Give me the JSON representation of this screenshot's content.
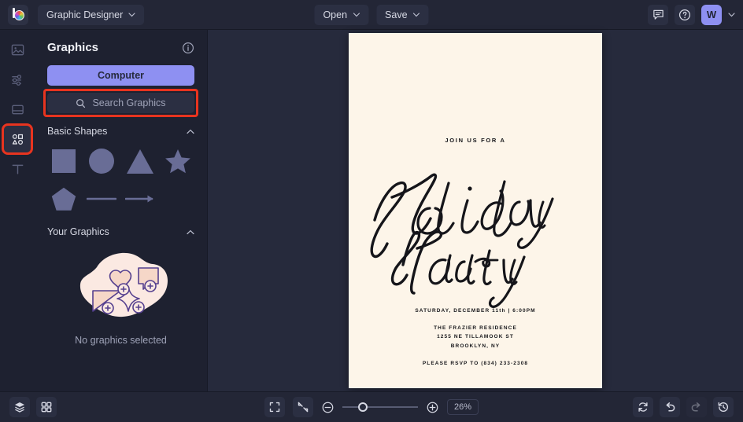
{
  "app": {
    "name": "BeFunky Graphic Designer",
    "logo_icon": "befunky-color-wheel-logo",
    "document_name": "Graphic Designer"
  },
  "topbar": {
    "open_label": "Open",
    "save_label": "Save",
    "open_icon": "chevron-down-icon",
    "save_icon": "chevron-down-icon",
    "doc_chevron_icon": "chevron-down-icon",
    "feedback_icon": "chat-bubble-icon",
    "help_icon": "help-circle-icon",
    "avatar_initial": "W",
    "avatar_chevron_icon": "chevron-down-icon"
  },
  "rail": {
    "items": [
      {
        "name": "image-tool",
        "icon": "image-icon",
        "active": false
      },
      {
        "name": "edit-tool",
        "icon": "sliders-icon",
        "active": false
      },
      {
        "name": "template-tool",
        "icon": "frame-icon",
        "active": false
      },
      {
        "name": "graphics-tool",
        "icon": "shapes-grid-icon",
        "active": true
      },
      {
        "name": "text-tool",
        "icon": "text-t-icon",
        "active": false
      }
    ]
  },
  "panel": {
    "title": "Graphics",
    "info_icon": "info-circle-icon",
    "computer_button": "Computer",
    "search_placeholder": "Search Graphics",
    "search_icon": "search-icon",
    "sections": [
      {
        "title": "Basic Shapes",
        "collapse_icon": "chevron-up-icon"
      },
      {
        "title": "Your Graphics",
        "collapse_icon": "chevron-up-icon"
      }
    ],
    "shapes": [
      {
        "name": "square-shape",
        "icon": "square-icon"
      },
      {
        "name": "circle-shape",
        "icon": "circle-icon"
      },
      {
        "name": "triangle-shape",
        "icon": "triangle-icon"
      },
      {
        "name": "star-shape",
        "icon": "star-icon"
      },
      {
        "name": "pentagon-shape",
        "icon": "pentagon-icon"
      },
      {
        "name": "line-shape",
        "icon": "line-icon"
      },
      {
        "name": "arrow-shape",
        "icon": "arrow-icon"
      }
    ],
    "empty_state": "No graphics selected",
    "empty_illustration_icon": "graphics-blob-illustration"
  },
  "canvas": {
    "eyebrow": "JOIN US FOR A",
    "headline_line1": "Holiday",
    "headline_line2": "Party",
    "date_line": "SATURDAY, DECEMBER 11th | 6:00PM",
    "venue": "THE FRAZIER RESIDENCE",
    "street": "1255 NE TILLAMOOK ST",
    "city": "BROOKLYN, NY",
    "rsvp": "PLEASE RSVP TO (834) 233-2308"
  },
  "bottombar": {
    "layers_icon": "layers-icon",
    "grid_icon": "grid-icon",
    "fullscreen_icon": "expand-icon",
    "fit_icon": "fit-to-screen-icon",
    "zoom_out_icon": "minus-circle-icon",
    "zoom_in_icon": "plus-circle-icon",
    "zoom_level": "26%",
    "reset_icon": "reset-icon",
    "undo_icon": "undo-icon",
    "redo_icon": "redo-icon",
    "history_icon": "history-icon",
    "slider_position_pct": 26
  },
  "colors": {
    "accent_purple": "#8e90f2",
    "highlight_red": "#e8341f",
    "topbar_bg": "#232636",
    "panel_bg": "#1e2130",
    "workspace_bg": "#262a3c",
    "canvas_bg": "#fdf5e9",
    "shape_fill": "#696d96"
  }
}
